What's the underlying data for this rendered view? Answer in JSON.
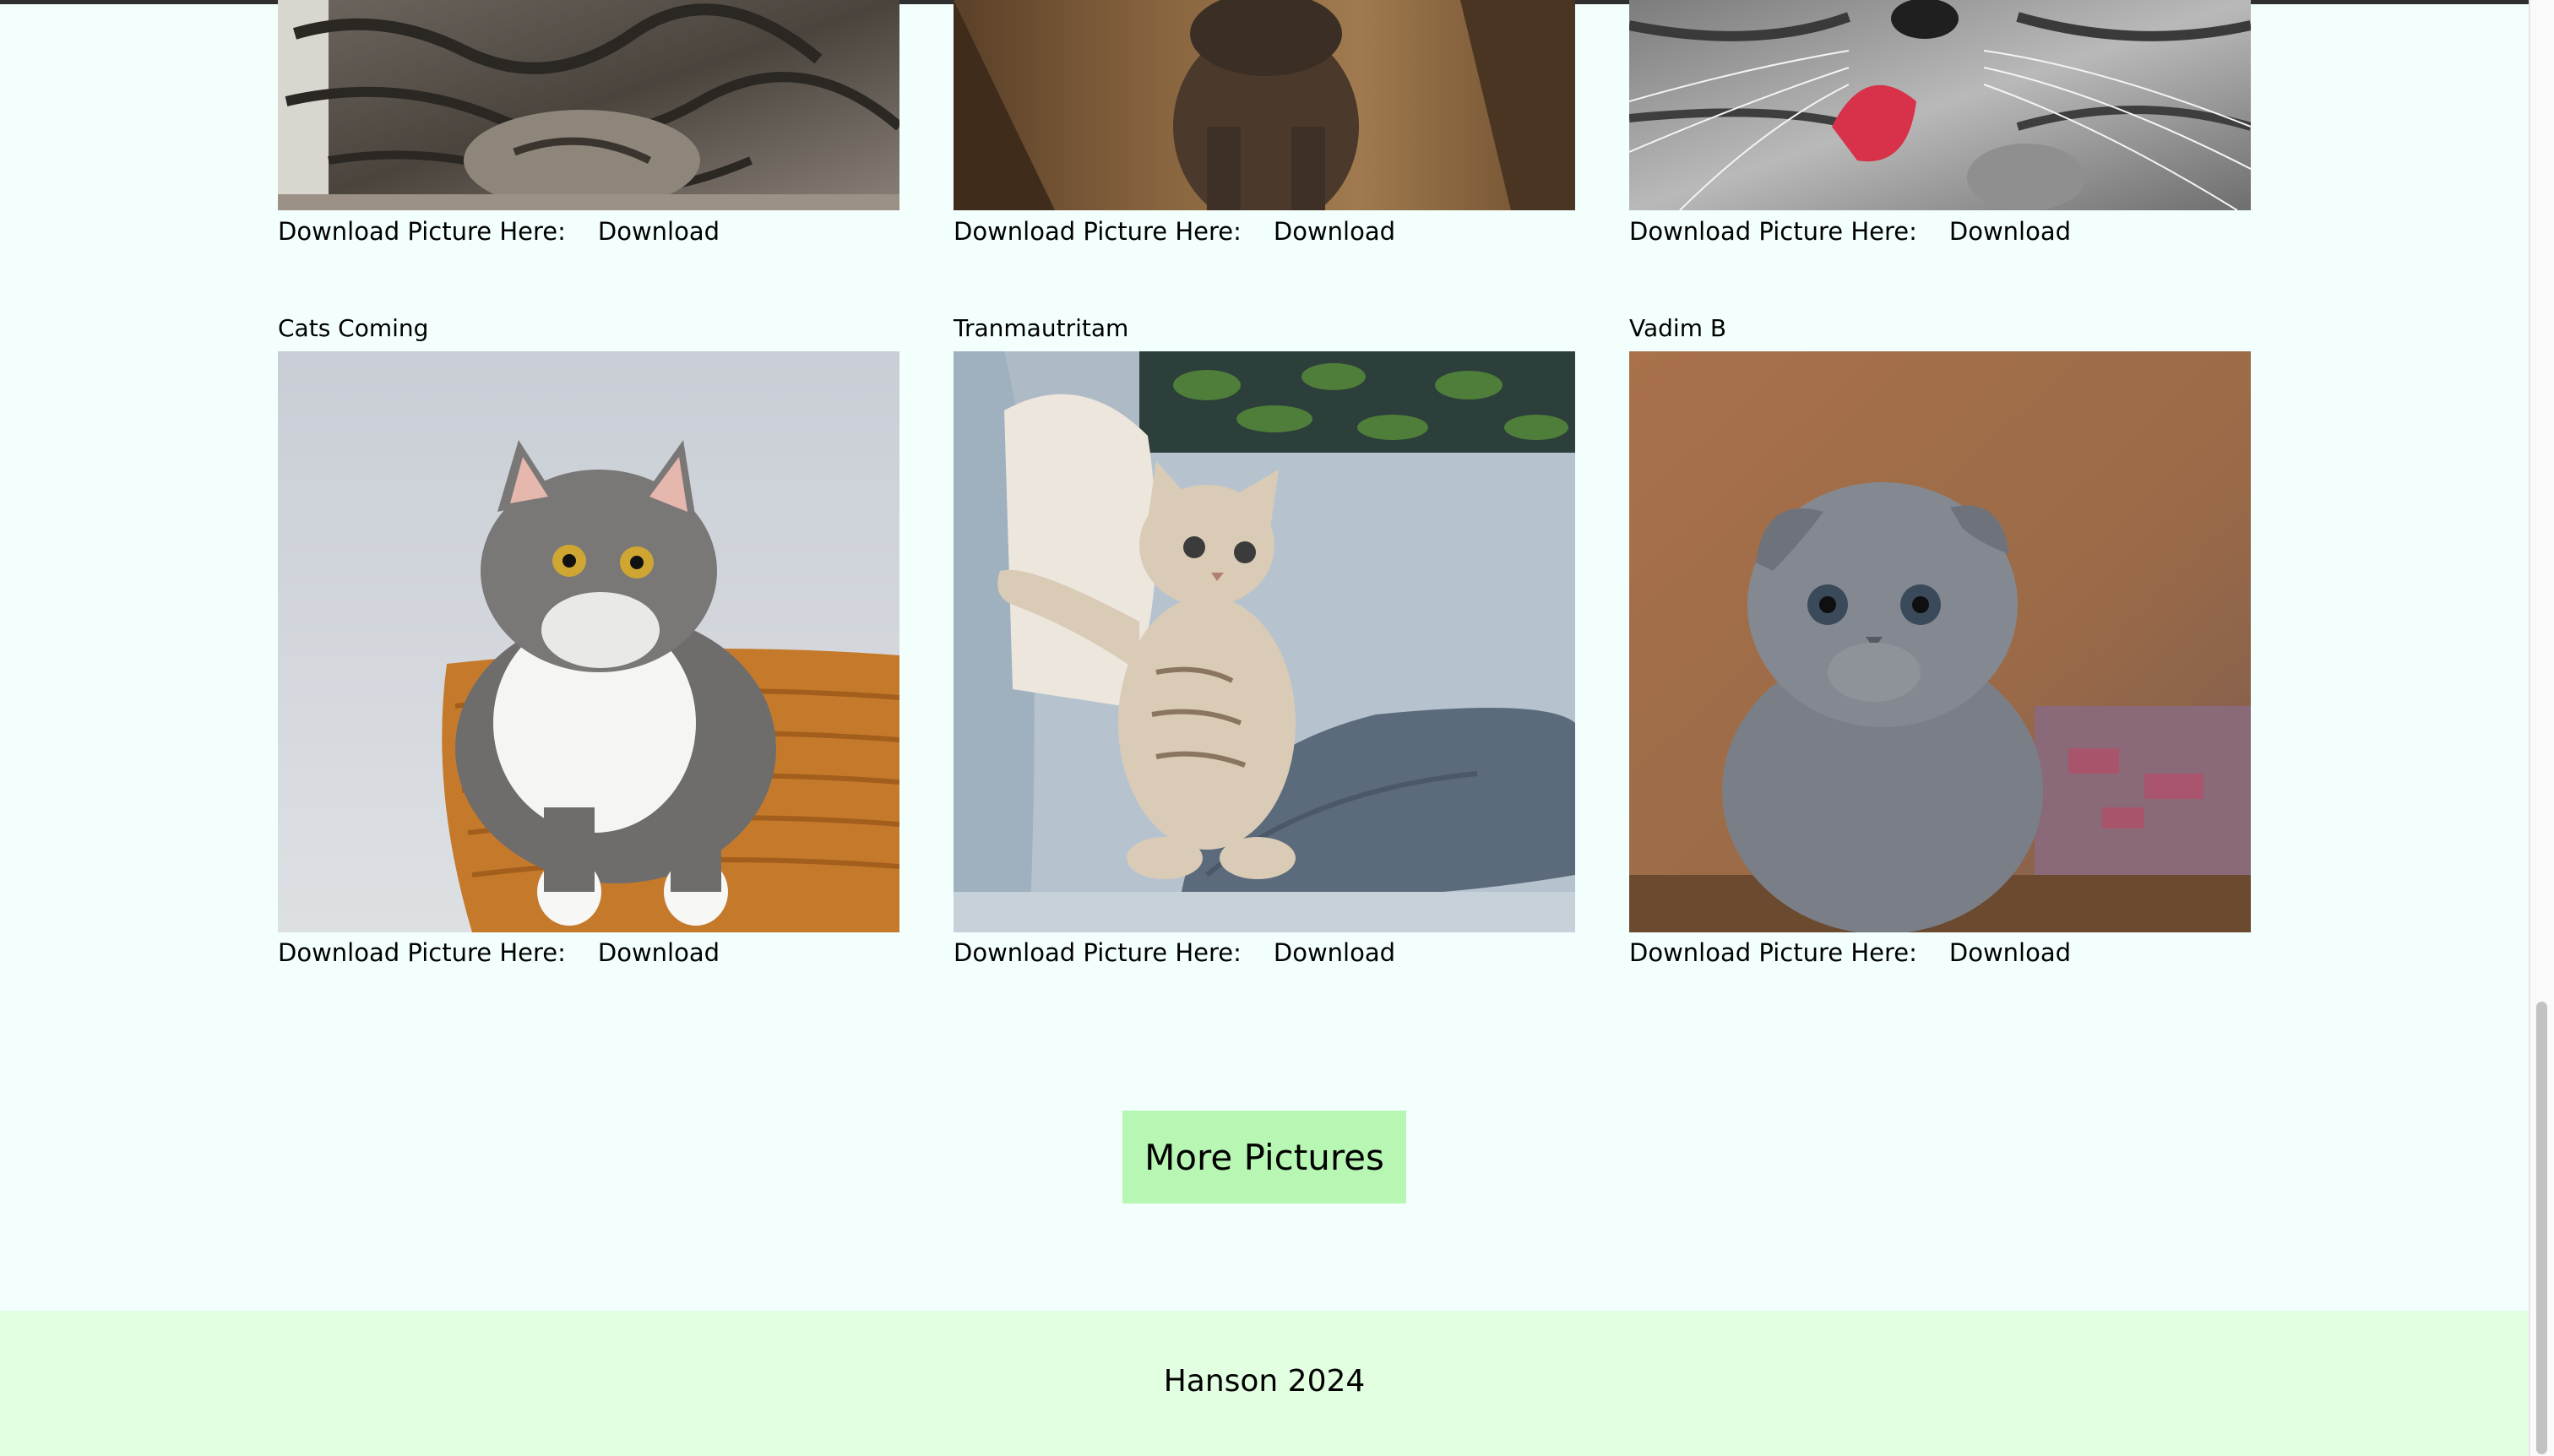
{
  "gallery": {
    "top_row": [
      {
        "download_label": "Download Picture Here:",
        "download_link": "Download"
      },
      {
        "download_label": "Download Picture Here:",
        "download_link": "Download"
      },
      {
        "download_label": "Download Picture Here:",
        "download_link": "Download"
      }
    ],
    "bottom_row": [
      {
        "name": "Cats Coming",
        "download_label": "Download Picture Here:",
        "download_link": "Download"
      },
      {
        "name": "Tranmautritam",
        "download_label": "Download Picture Here:",
        "download_link": "Download"
      },
      {
        "name": "Vadim B",
        "download_label": "Download Picture Here:",
        "download_link": "Download"
      }
    ]
  },
  "more_button": {
    "label": "More Pictures"
  },
  "footer": {
    "text": "Hanson 2024"
  },
  "colors": {
    "page_bg": "#f2fffd",
    "button_bg": "#b8f7b3",
    "footer_bg": "#e3ffe1"
  }
}
